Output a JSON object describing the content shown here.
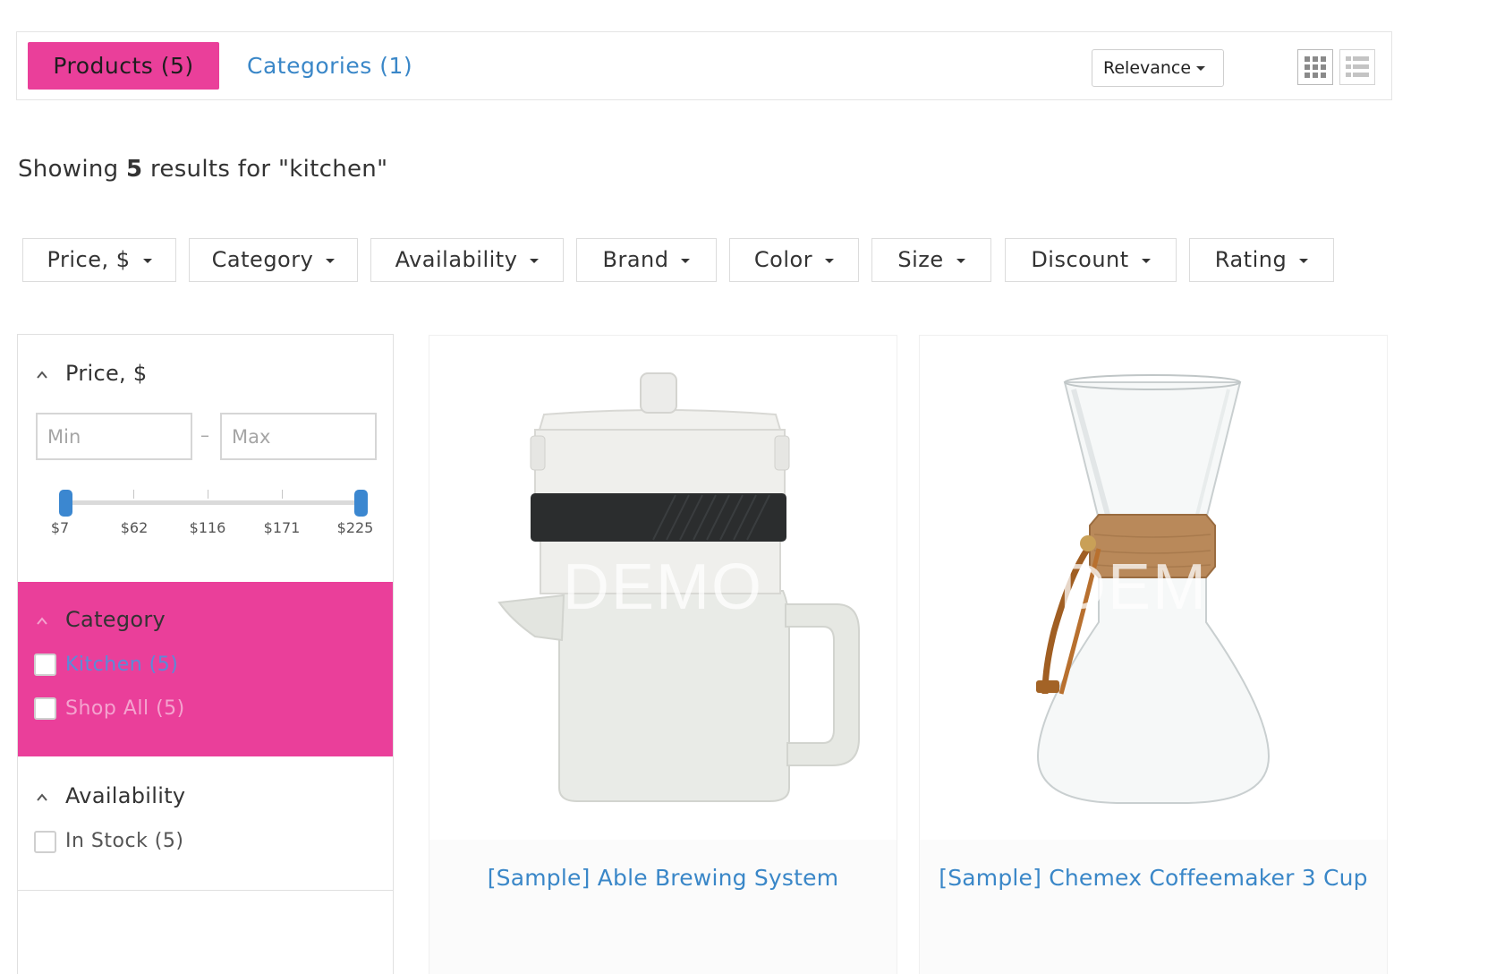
{
  "tabs": {
    "products_label": "Products (5)",
    "categories_label": "Categories (1)"
  },
  "sort": {
    "selected": "Relevance"
  },
  "results": {
    "prefix": "Showing ",
    "count": "5",
    "suffix": " results for \"kitchen\""
  },
  "filters": [
    {
      "label": "Price, $"
    },
    {
      "label": "Category"
    },
    {
      "label": "Availability"
    },
    {
      "label": "Brand"
    },
    {
      "label": "Color"
    },
    {
      "label": "Size"
    },
    {
      "label": "Discount"
    },
    {
      "label": "Rating"
    }
  ],
  "sidebar": {
    "price": {
      "title": "Price, $",
      "min_placeholder": "Min",
      "max_placeholder": "Max",
      "dash": "–",
      "ticks": [
        "$7",
        "$62",
        "$116",
        "$171",
        "$225"
      ],
      "range": {
        "min": 7,
        "max": 225,
        "selected_min": 7,
        "selected_max": 225
      }
    },
    "category": {
      "title": "Category",
      "items": [
        {
          "label": "Kitchen (5)",
          "checked": false,
          "color": "#5a8bd8"
        },
        {
          "label": "Shop All (5)",
          "checked": false,
          "color": "#f4a3cf"
        }
      ]
    },
    "availability": {
      "title": "Availability",
      "items": [
        {
          "label": "In Stock (5)",
          "checked": false
        }
      ]
    }
  },
  "products": [
    {
      "title": "[Sample] Able Brewing System",
      "watermark": "DEMO"
    },
    {
      "title": "[Sample] Chemex Coffeemaker 3 Cup",
      "watermark": "DEMO"
    }
  ],
  "colors": {
    "accent": "#ea3f9a",
    "link": "#3a87c8",
    "slider": "#3b87d0"
  },
  "icons": {
    "sort_caret": "caret-down-icon",
    "grid_view": "grid-view-icon",
    "list_view": "list-view-icon",
    "collapse": "chevron-up-icon"
  }
}
